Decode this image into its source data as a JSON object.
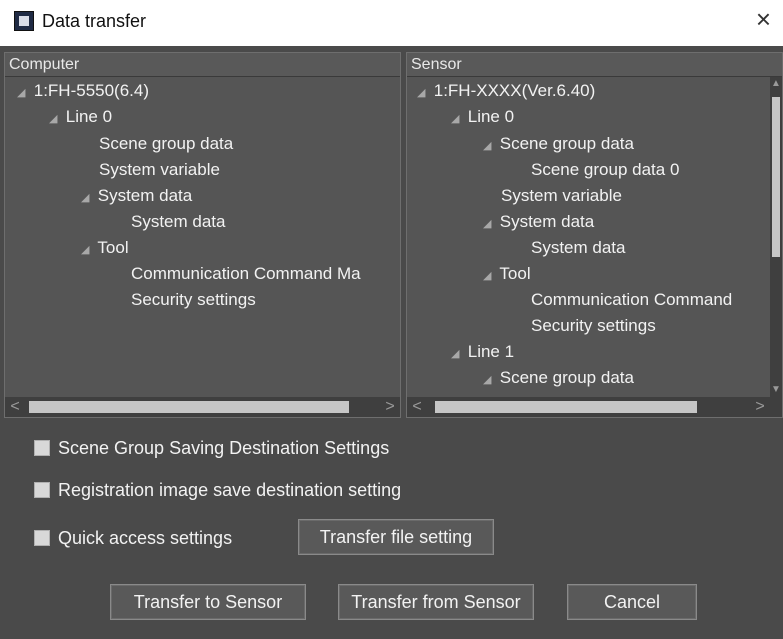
{
  "window": {
    "title": "Data transfer",
    "close_glyph": "×",
    "icon": "app-icon"
  },
  "computer_panel": {
    "header": "Computer",
    "tree": [
      {
        "label": "1:FH-5550(6.4)",
        "expanded": true
      },
      {
        "label": "Line 0",
        "expanded": true
      },
      {
        "label": "Scene group data",
        "expanded": false
      },
      {
        "label": "System variable",
        "expanded": false
      },
      {
        "label": "System data",
        "expanded": true
      },
      {
        "label": "System data",
        "expanded": false
      },
      {
        "label": "Tool",
        "expanded": true
      },
      {
        "label": "Communication Command Ma",
        "expanded": false
      },
      {
        "label": "Security settings",
        "expanded": false
      }
    ]
  },
  "sensor_panel": {
    "header": "Sensor",
    "tree": [
      {
        "label": "1:FH-XXXX(Ver.6.40)",
        "expanded": true
      },
      {
        "label": "Line 0",
        "expanded": true
      },
      {
        "label": "Scene group data",
        "expanded": true
      },
      {
        "label": "Scene group data 0",
        "expanded": false
      },
      {
        "label": "System variable",
        "expanded": false
      },
      {
        "label": "System data",
        "expanded": true
      },
      {
        "label": "System data",
        "expanded": false
      },
      {
        "label": "Tool",
        "expanded": true
      },
      {
        "label": "Communication Command",
        "expanded": false
      },
      {
        "label": "Security settings",
        "expanded": false
      },
      {
        "label": "Line 1",
        "expanded": true
      },
      {
        "label": "Scene group data",
        "expanded": true
      }
    ]
  },
  "options": {
    "scene_group_saving": "Scene Group Saving Destination Settings",
    "registration_image": "Registration image save destination setting",
    "quick_access": "Quick access settings",
    "transfer_file_setting": "Transfer file setting"
  },
  "buttons": {
    "transfer_to_sensor": "Transfer to Sensor",
    "transfer_from_sensor": "Transfer from Sensor",
    "cancel": "Cancel"
  },
  "expand_glyph": "◢",
  "scroll_left_glyph": "<",
  "scroll_right_glyph": ">",
  "scroll_up_glyph": "▲",
  "scroll_down_glyph": "▼"
}
